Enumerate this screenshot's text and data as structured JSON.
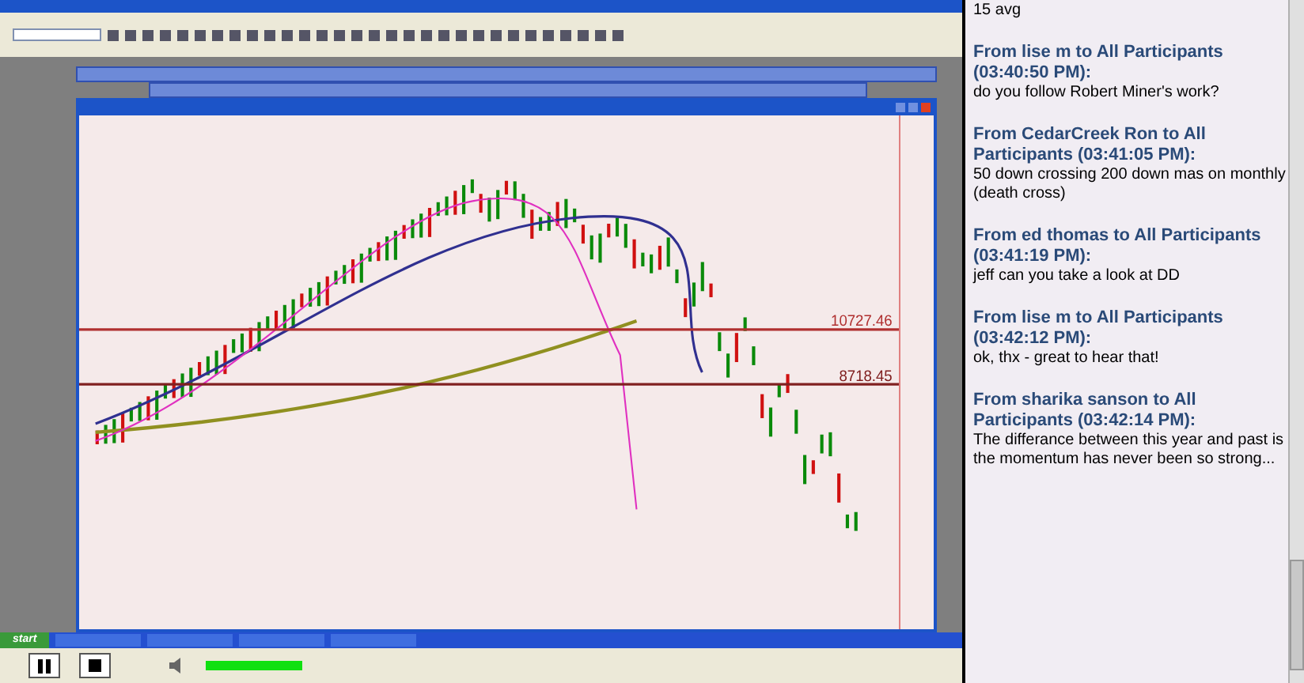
{
  "chart": {
    "price_levels": [
      {
        "label": "10727.46",
        "kind": "resistance"
      },
      {
        "label": "8718.45",
        "kind": "support"
      }
    ]
  },
  "taskbar": {
    "start": "start"
  },
  "player": {
    "volume": {
      "level": 0.95
    }
  },
  "chat": {
    "partial_line": "15 avg",
    "messages": [
      {
        "header": "From lise m to All Participants (03:40:50 PM):",
        "body": "do you follow Robert Miner's work?"
      },
      {
        "header": "From CedarCreek Ron to All Participants (03:41:05 PM):",
        "body": "50 down crossing 200 down mas on monthly (death cross)"
      },
      {
        "header": "From ed thomas to All Participants (03:41:19 PM):",
        "body": "jeff can you take a look at DD"
      },
      {
        "header": "From lise m to All Participants (03:42:12 PM):",
        "body": "ok, thx - great to hear that!"
      },
      {
        "header": "From sharika sanson to All Participants (03:42:14 PM):",
        "body": "The differance between this year and past is the momentum has never been so strong..."
      }
    ]
  }
}
